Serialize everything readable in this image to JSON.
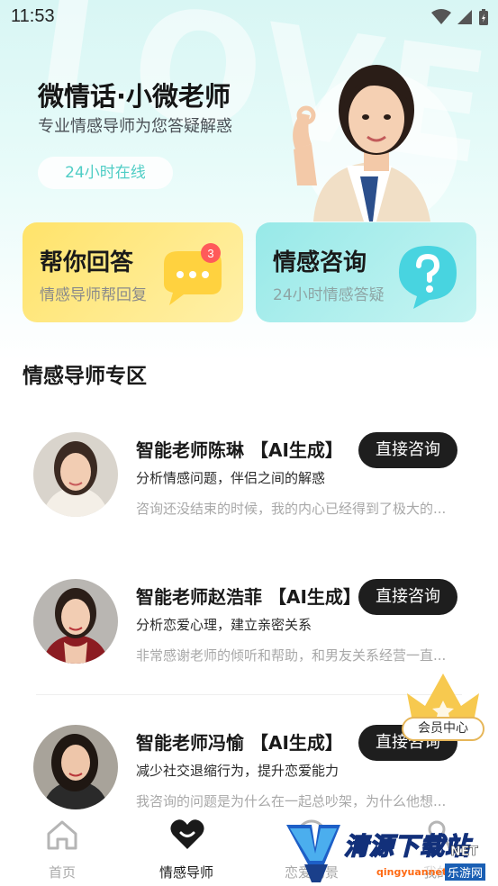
{
  "status_bar": {
    "time": "11:53"
  },
  "hero": {
    "decor_text": "LOVE",
    "title": "微情话·小微老师",
    "subtitle": "专业情感导师为您答疑解惑",
    "online_badge": "24小时在线"
  },
  "feature_cards": [
    {
      "title": "帮你回答",
      "subtitle": "情感导师帮回复",
      "badge_count": "3",
      "icon": "chat-bubble-icon",
      "color": "#ffe36a"
    },
    {
      "title": "情感咨询",
      "subtitle": "24小时情感答疑",
      "icon": "question-bubble-icon",
      "color": "#97e9e8"
    }
  ],
  "section": {
    "title": "情感导师专区"
  },
  "teachers": [
    {
      "name": "智能老师陈琳 【AI生成】",
      "button": "直接咨询",
      "desc": "分析情感问题，伴侣之间的解惑",
      "quote": "咨询还没结束的时候，我的内心已经得到了极大的..."
    },
    {
      "name": "智能老师赵浩菲 【AI生成】",
      "button": "直接咨询",
      "desc": "分析恋爱心理，建立亲密关系",
      "quote": "非常感谢老师的倾听和帮助，和男友关系经营一直..."
    },
    {
      "name": "智能老师冯愉 【AI生成】",
      "button": "直接咨询",
      "desc": "减少社交退缩行为，提升恋爱能力",
      "quote": "我咨询的问题是为什么在一起总吵架，为什么他想..."
    }
  ],
  "vip": {
    "label": "会员中心",
    "icon": "crown-icon"
  },
  "tabbar": {
    "items": [
      {
        "label": "首页",
        "icon": "home-icon"
      },
      {
        "label": "情感导师",
        "icon": "heart-icon"
      },
      {
        "label": "恋爱场景",
        "icon": "scene-icon"
      },
      {
        "label": "我的",
        "icon": "user-icon"
      }
    ]
  },
  "watermark": {
    "title": "清源下载站",
    "net": "NET",
    "sub": "qingyuannet.com",
    "sub2": "乐游网"
  },
  "colors": {
    "accent": "#3fc9c0",
    "yellow_card": "#ffe36a",
    "cyan_card": "#97e9e8",
    "button": "#1e1e1e"
  }
}
